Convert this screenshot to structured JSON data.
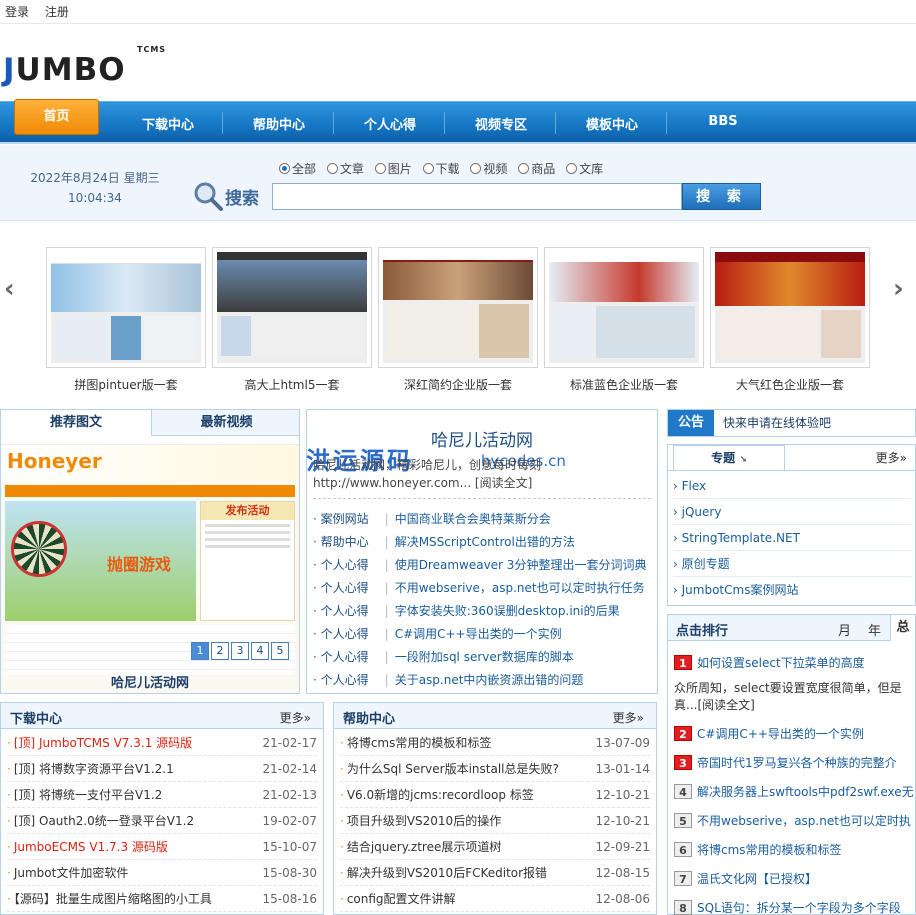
{
  "topbar": {
    "login": "登录",
    "register": "注册"
  },
  "logo": {
    "text_j": "J",
    "text_rest": "UMBO",
    "sub": "TCMS"
  },
  "nav": {
    "items": [
      "首页",
      "下载中心",
      "帮助中心",
      "个人心得",
      "视频专区",
      "模板中心",
      "BBS"
    ]
  },
  "datetime": {
    "date": "2022年8月24日 星期三",
    "time": "10:04:34"
  },
  "search": {
    "label": "搜索",
    "button": "搜 索",
    "options": [
      "全部",
      "文章",
      "图片",
      "下载",
      "视频",
      "商品",
      "文库"
    ],
    "selected": "全部",
    "value": ""
  },
  "carousel": {
    "prev": "‹",
    "next": "›",
    "items": [
      "拼图pintuer版一套",
      "高大上html5一套",
      "深红简约企业版一套",
      "标准蓝色企业版一套",
      "大气红色企业版一套"
    ]
  },
  "featured": {
    "tabs": [
      "推荐图文",
      "最新视频"
    ],
    "caption": "哈尼儿活动网",
    "pages": [
      "1",
      "2",
      "3",
      "4",
      "5"
    ],
    "image_texts": {
      "brand": "Honeyer",
      "post": "发布活动",
      "game": "抛圈游戏"
    }
  },
  "headline": {
    "title": "哈尼儿活动网",
    "watermark": "洪运源码",
    "watermark_url": "hycodes.cn",
    "summary": "哈尼儿活动网，精彩哈尼儿，创意每时每刻",
    "url": "http://www.honeyer.com...",
    "readmore": "[阅读全文]"
  },
  "news": [
    {
      "cat": "案例网站",
      "title": "中国商业联合会奥特莱斯分会"
    },
    {
      "cat": "帮助中心",
      "title": "解决MSScriptControl出错的方法"
    },
    {
      "cat": "个人心得",
      "title": "使用Dreamweaver 3分钟整理出一套分词词典"
    },
    {
      "cat": "个人心得",
      "title": "不用webserive，asp.net也可以定时执行任务"
    },
    {
      "cat": "个人心得",
      "title": "字体安装失败:360误删desktop.ini的后果"
    },
    {
      "cat": "个人心得",
      "title": "C#调用C++导出类的一个实例"
    },
    {
      "cat": "个人心得",
      "title": "一段附加sql server数据库的脚本"
    },
    {
      "cat": "个人心得",
      "title": "关于asp.net中内嵌资源出错的问题"
    }
  ],
  "notice": {
    "label": "公告",
    "text": "快来申请在线体验吧"
  },
  "topics": {
    "tab": "专题",
    "more": "更多»",
    "items": [
      "Flex",
      "jQuery",
      "StringTemplate.NET",
      "原创专题",
      "JumbotCms案例网站"
    ]
  },
  "ranking": {
    "title": "点击排行",
    "tabs": [
      "月",
      "年",
      "总"
    ],
    "active_tab": "总",
    "first": {
      "title": "如何设置select下拉菜单的高度",
      "desc1": "众所周知，select要设置宽度很简单，但是",
      "desc2": "真...[阅读全文]"
    },
    "items": [
      {
        "n": "1",
        "title": "如何设置select下拉菜单的高度"
      },
      {
        "n": "2",
        "title": "C#调用C++导出类的一个实例"
      },
      {
        "n": "3",
        "title": "帝国时代1罗马复兴各个种族的完整介"
      },
      {
        "n": "4",
        "title": "解决服务器上swftools中pdf2swf.exe无"
      },
      {
        "n": "5",
        "title": "不用webserive，asp.net也可以定时执"
      },
      {
        "n": "6",
        "title": "将博cms常用的模板和标签"
      },
      {
        "n": "7",
        "title": "温氏文化网【已授权】"
      },
      {
        "n": "8",
        "title": "SQL语句：拆分某一个字段为多个字段"
      }
    ]
  },
  "downloads": {
    "title": "下载中心",
    "more": "更多»",
    "rows": [
      {
        "title": "[顶] JumboTCMS V7.3.1 源码版",
        "date": "21-02-17",
        "red": true
      },
      {
        "title": "[顶] 将博数字资源平台V1.2.1",
        "date": "21-02-14",
        "red": false
      },
      {
        "title": "[顶] 将博统一支付平台V1.2",
        "date": "21-02-13",
        "red": false
      },
      {
        "title": "[顶] Oauth2.0统一登录平台V1.2",
        "date": "19-02-07",
        "red": false
      },
      {
        "title": "JumboECMS V1.7.3 源码版",
        "date": "15-10-07",
        "red": true
      },
      {
        "title": "Jumbot文件加密软件",
        "date": "15-08-30",
        "red": false
      },
      {
        "title": "【源码】批量生成图片缩略图的小工具",
        "date": "15-08-16",
        "red": false
      }
    ]
  },
  "help": {
    "title": "帮助中心",
    "more": "更多»",
    "rows": [
      {
        "title": "将博cms常用的模板和标签",
        "date": "13-07-09"
      },
      {
        "title": "为什么Sql Server版本install总是失败?",
        "date": "13-01-14"
      },
      {
        "title": "V6.0新增的jcms:recordloop 标签",
        "date": "12-10-21"
      },
      {
        "title": "项目升级到VS2010后的操作",
        "date": "12-10-21"
      },
      {
        "title": "结合jquery.ztree展示项道树",
        "date": "12-09-21"
      },
      {
        "title": "解决升级到VS2010后FCKeditor报错",
        "date": "12-08-15"
      },
      {
        "title": "config配置文件讲解",
        "date": "12-08-06"
      }
    ]
  }
}
